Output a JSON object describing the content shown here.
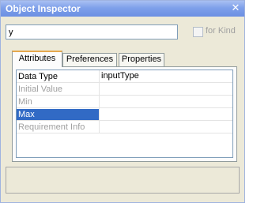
{
  "window": {
    "title": "Object Inspector"
  },
  "search": {
    "value": "y"
  },
  "for_kind": {
    "label": "for Kind",
    "checked": false
  },
  "tabs": [
    {
      "label": "Attributes",
      "active": true
    },
    {
      "label": "Preferences",
      "active": false
    },
    {
      "label": "Properties",
      "active": false
    }
  ],
  "attributes": [
    {
      "name": "Data Type",
      "value": "inputType",
      "state": "normal"
    },
    {
      "name": "Initial Value",
      "value": "",
      "state": "disabled"
    },
    {
      "name": "Min",
      "value": "",
      "state": "disabled"
    },
    {
      "name": "Max",
      "value": "",
      "state": "selected"
    },
    {
      "name": "Requirement Info",
      "value": "",
      "state": "disabled"
    }
  ],
  "status": {
    "text": ""
  },
  "colors": {
    "title_gradient_end": "#6b8fe3",
    "selection": "#316ac5",
    "tab_highlight": "#e6a84d"
  }
}
